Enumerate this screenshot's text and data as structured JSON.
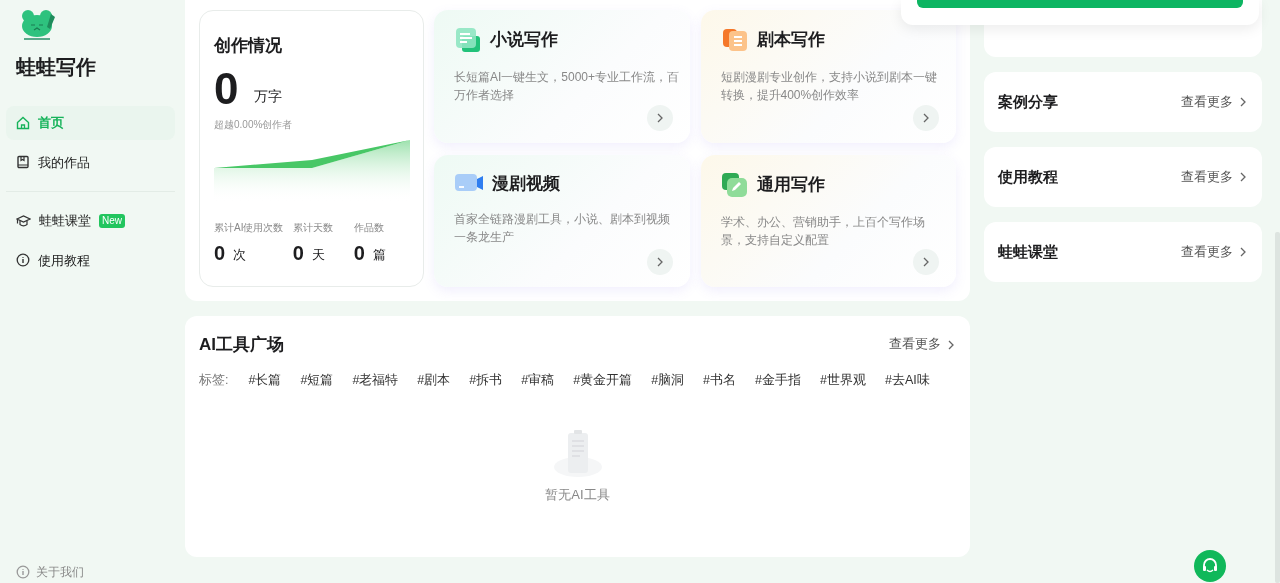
{
  "app": {
    "name": "蛙蛙写作"
  },
  "sidebar": {
    "items": [
      {
        "label": "首页",
        "kind": "home",
        "selected": true
      },
      {
        "label": "我的作品",
        "kind": "book",
        "selected": false
      },
      {
        "label": "蛙蛙课堂",
        "kind": "cap",
        "selected": false,
        "badge": "New"
      },
      {
        "label": "使用教程",
        "kind": "info",
        "selected": false
      }
    ],
    "footer": "关于我们"
  },
  "stats": {
    "title": "创作情况",
    "total": "0",
    "total_unit": "万字",
    "rank": "超越0.00%创作者",
    "metrics": [
      {
        "label": "累计AI使用次数",
        "value": "0",
        "unit": "次"
      },
      {
        "label": "累计天数",
        "value": "0",
        "unit": "天"
      },
      {
        "label": "作品数",
        "value": "0",
        "unit": "篇"
      }
    ]
  },
  "features": [
    {
      "title": "小说写作",
      "desc": "长短篇AI一键生文，5000+专业工作流，百万作者选择",
      "kind": "novel"
    },
    {
      "title": "剧本写作",
      "desc": "短剧漫剧专业创作，支持小说到剧本一键转换，提升400%创作效率",
      "kind": "script"
    },
    {
      "title": "漫剧视频",
      "desc": "首家全链路漫剧工具，小说、剧本到视频一条龙生产",
      "kind": "video"
    },
    {
      "title": "通用写作",
      "desc": "学术、办公、营销助手，上百个写作场景，支持自定义配置",
      "kind": "general"
    }
  ],
  "popup": true,
  "side_cards": [
    {
      "title": "案例分享",
      "link": "查看更多"
    },
    {
      "title": "使用教程",
      "link": "查看更多"
    },
    {
      "title": "蛙蛙课堂",
      "link": "查看更多"
    }
  ],
  "tools": {
    "title": "AI工具广场",
    "link": "查看更多",
    "tags_label": "标签:",
    "tags": [
      "#长篇",
      "#短篇",
      "#老福特",
      "#剧本",
      "#拆书",
      "#审稿",
      "#黄金开篇",
      "#脑洞",
      "#书名",
      "#金手指",
      "#世界观",
      "#去AI味"
    ],
    "empty": "暂无AI工具"
  }
}
